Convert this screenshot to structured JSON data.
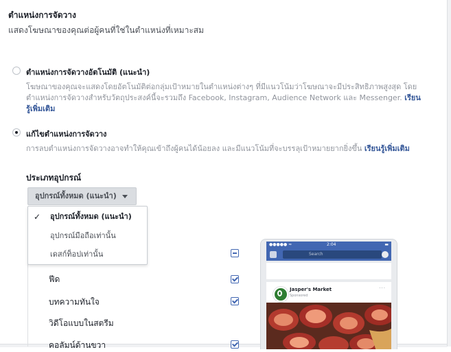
{
  "header": {
    "title": "ตำแหน่งการจัดวาง",
    "subtitle": "แสดงโฆษณาของคุณต่อผู้คนที่ใช่ในตำแหน่งที่เหมาะสม"
  },
  "options": {
    "auto": {
      "label": "ตำแหน่งการจัดวางอัตโนมัติ (แนะนำ)",
      "desc_line1": "โฆษณาของคุณจะแสดงโดยอัตโนมัติต่อกลุ่มเป้าหมายในตำแหน่งต่างๆ ที่มีแนวโน้มว่าโฆษณาจะมีประสิทธิภาพสูงสุด โดย",
      "desc_line2": "ตำแหน่งการจัดวางสำหรับวัตถุประสงค์นี้จะรวมถึง Facebook, Instagram, Audience Network และ Messenger.",
      "link_part1": "เรียน",
      "link_part2": "รู้เพิ่มเติม",
      "selected": false
    },
    "edit": {
      "label": "แก้ไขตำแหน่งการจัดวาง",
      "desc": "การลบตำแหน่งการจัดวางอาจทำให้คุณเข้าถึงผู้คนได้น้อยลง และมีแนวโน้มที่จะบรรลุเป้าหมายยากยิ่งขึ้น",
      "link": "เรียนรู้เพิ่มเติม",
      "selected": true
    }
  },
  "device_type": {
    "label": "ประเภทอุปกรณ์",
    "selected": "อุปกรณ์ทั้งหมด (แนะนำ)",
    "options": [
      "อุปกรณ์ทั้งหมด (แนะนำ)",
      "อุปกรณ์มือถือเท่านั้น",
      "เดสก์ท็อปเท่านั้น"
    ]
  },
  "placements": [
    {
      "label": "",
      "state": "indeterminate"
    },
    {
      "label": "ฟีด",
      "state": "checked"
    },
    {
      "label": "บทความทันใจ",
      "state": "checked"
    },
    {
      "label": "วิดีโอแบบในสตรีม",
      "state": "none"
    },
    {
      "label": "คอลัมน์ด้านขวา",
      "state": "checked"
    }
  ],
  "preview": {
    "status_time": "2:04",
    "status_signal": "●●●●● ≈",
    "status_battery": "▬",
    "search_placeholder": "Search",
    "brand_name": "Jasper's Market",
    "sponsored": "Sponsored",
    "more": "···"
  },
  "colors": {
    "facebook_blue": "#4267b2",
    "link_blue": "#365899",
    "muted_text": "#90949c"
  }
}
